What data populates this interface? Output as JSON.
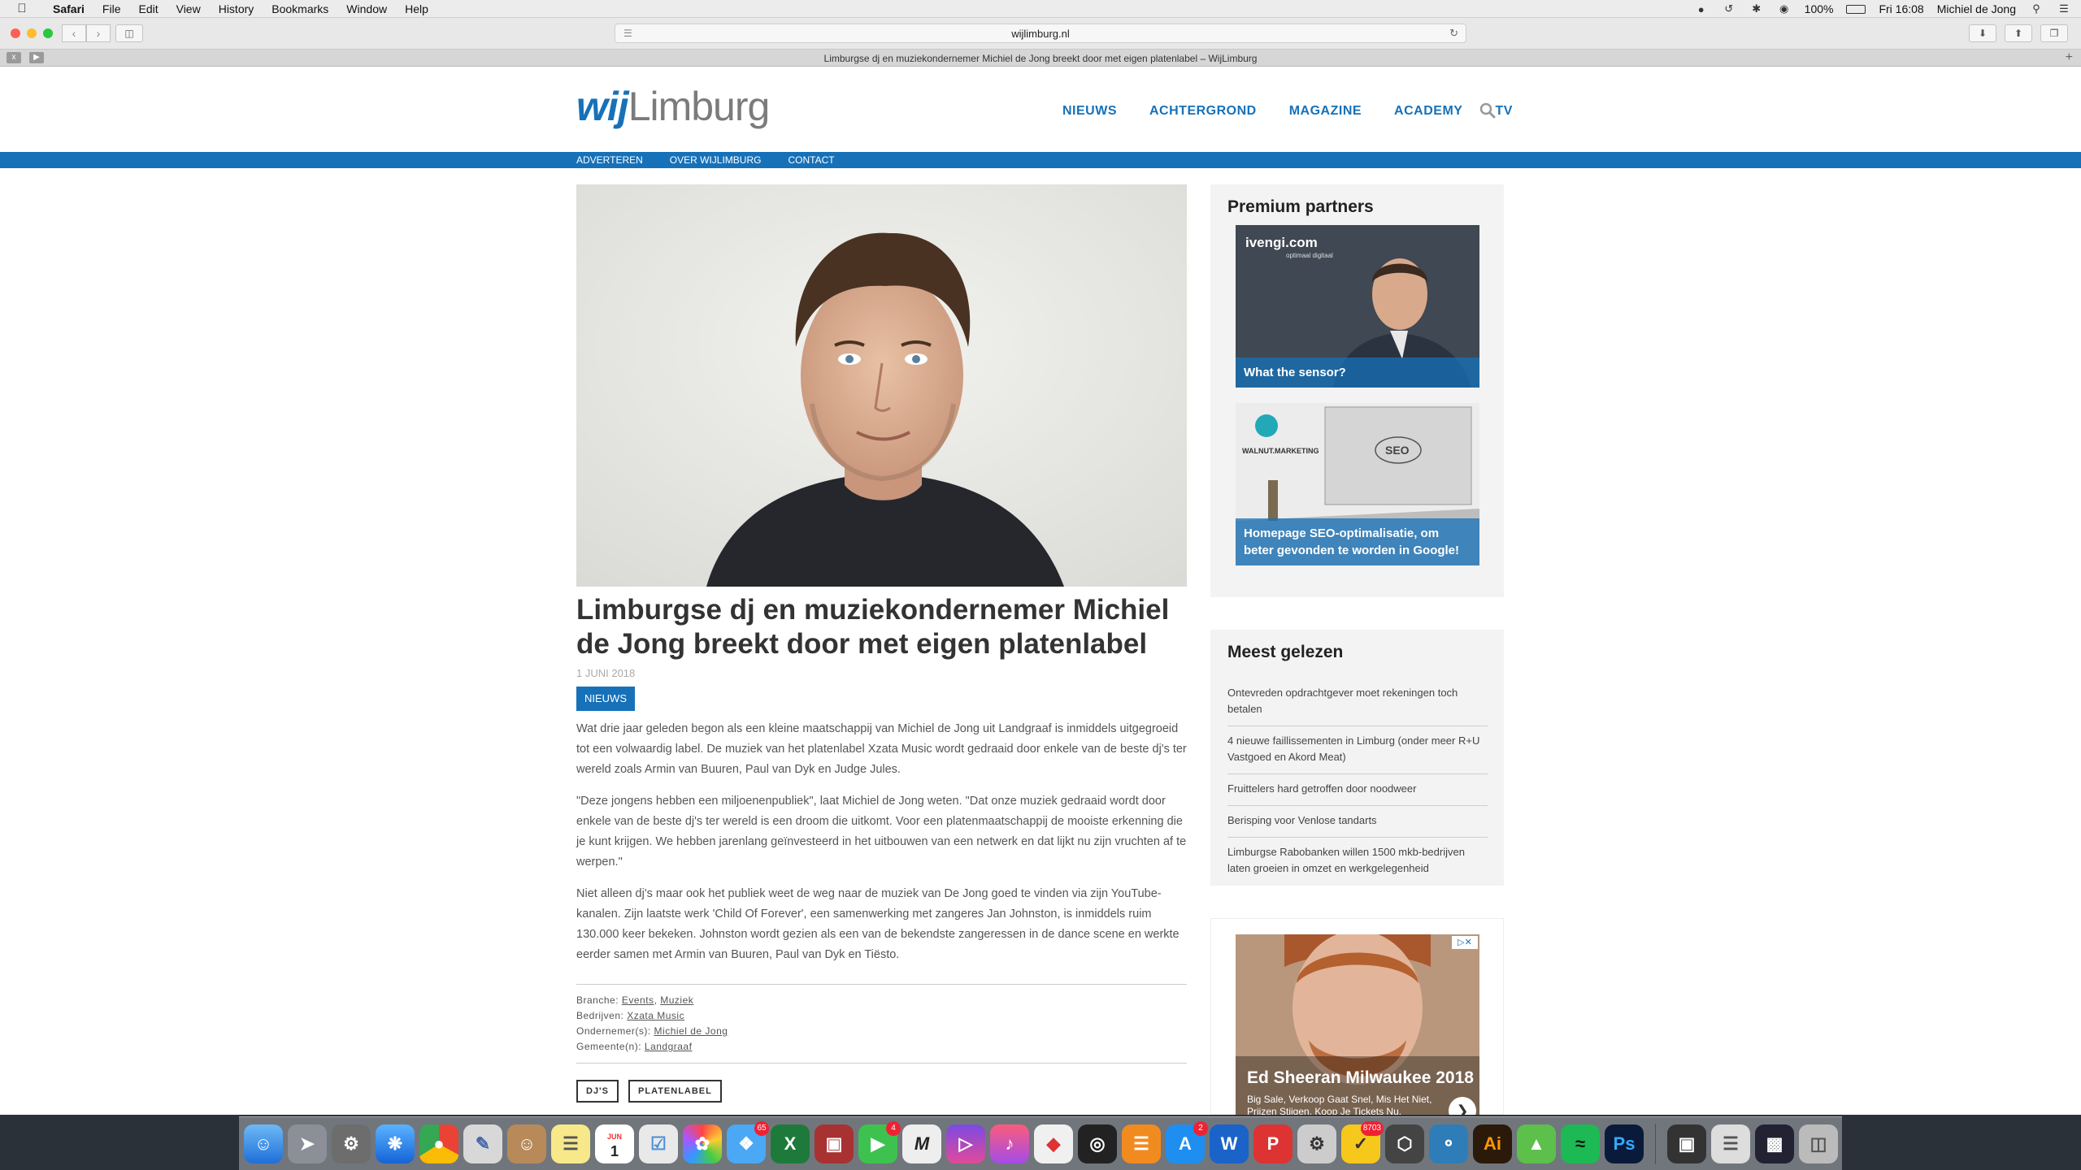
{
  "menubar": {
    "app": "Safari",
    "items": [
      "File",
      "Edit",
      "View",
      "History",
      "Bookmarks",
      "Window",
      "Help"
    ],
    "battery": "100%",
    "clock": "Fri 16:08",
    "user": "Michiel de Jong"
  },
  "browser": {
    "url": "wijlimburg.nl",
    "tab_title": "Limburgse dj en muziekondernemer Michiel de Jong breekt door met eigen platenlabel – WijLimburg"
  },
  "site": {
    "logo_wij": "wij",
    "logo_limburg": "Limburg",
    "nav": [
      "NIEUWS",
      "ACHTERGROND",
      "MAGAZINE",
      "ACADEMY",
      "TV"
    ],
    "subnav": [
      "ADVERTEREN",
      "OVER WIJLIMBURG",
      "CONTACT"
    ]
  },
  "article": {
    "title": "Limburgse dj en muziekondernemer Michiel de Jong breekt door met eigen platenlabel",
    "date": "1 JUNI 2018",
    "category": "NIEUWS",
    "paragraphs": [
      "Wat drie jaar geleden begon als een kleine maatschappij van Michiel de Jong uit Landgraaf is inmiddels uitgegroeid tot een volwaardig label. De muziek van het platenlabel Xzata Music wordt gedraaid door enkele van de beste dj's ter wereld zoals Armin van Buuren, Paul van Dyk en Judge Jules.",
      "\"Deze jongens hebben een miljoenenpubliek\", laat Michiel de Jong weten. \"Dat onze muziek gedraaid wordt door enkele van de beste dj's ter wereld is een droom die uitkomt. Voor een platenmaatschappij de mooiste erkenning die je kunt krijgen. We hebben jarenlang geïnvesteerd in het uitbouwen van een netwerk en dat lijkt nu zijn vruchten af te werpen.\"",
      "Niet alleen dj's maar ook het publiek weet de weg naar de muziek van De Jong goed te vinden via zijn YouTube-kanalen. Zijn laatste werk 'Child Of Forever', een samenwerking met zangeres Jan Johnston, is inmiddels ruim 130.000 keer bekeken. Johnston wordt gezien als een van de bekendste zangeressen in de dance scene en werkte eerder samen met Armin van Buuren, Paul van Dyk en Tiësto."
    ],
    "meta": {
      "branche_label": "Branche:",
      "branche_1": "Events",
      "branche_2": "Muziek",
      "bedrijven_label": "Bedrijven:",
      "bedrijven": "Xzata Music",
      "ondernemer_label": "Ondernemer(s):",
      "ondernemer": "Michiel de Jong",
      "gemeente_label": "Gemeente(n):",
      "gemeente": "Landgraaf"
    },
    "tags": [
      "DJ'S",
      "PLATENLABEL"
    ]
  },
  "sidebar": {
    "partners_title": "Premium partners",
    "partners": [
      {
        "brand": "ivengi.com",
        "brand_sub": "optimaal digitaal",
        "caption": "What the sensor?"
      },
      {
        "brand": "WALNUT.MARKETING",
        "image_text": "SEO",
        "caption": "Homepage SEO-optimalisatie, om beter gevonden te worden in Google!"
      }
    ],
    "most_read_title": "Meest gelezen",
    "most_read": [
      "Ontevreden opdrachtgever moet rekeningen toch betalen",
      "4 nieuwe faillissementen in Limburg (onder meer R+U Vastgoed en Akord Meat)",
      "Fruittelers hard getroffen door noodweer",
      "Berisping voor Venlose tandarts",
      "Limburgse Rabobanken willen 1500 mkb-bedrijven laten groeien in omzet en werkgelegenheid"
    ],
    "ad": {
      "title": "Ed Sheeran Milwaukee 2018",
      "subtitle": "Big Sale, Verkoop Gaat Snel, Mis Het Niet, Prijzen Stijgen, Koop Je Tickets Nu."
    }
  },
  "dock": {
    "badges": {
      "messages": "65",
      "facetime": "4",
      "appstore": "2",
      "norton": "8703"
    },
    "calendar_month": "JUN",
    "calendar_day": "1"
  }
}
